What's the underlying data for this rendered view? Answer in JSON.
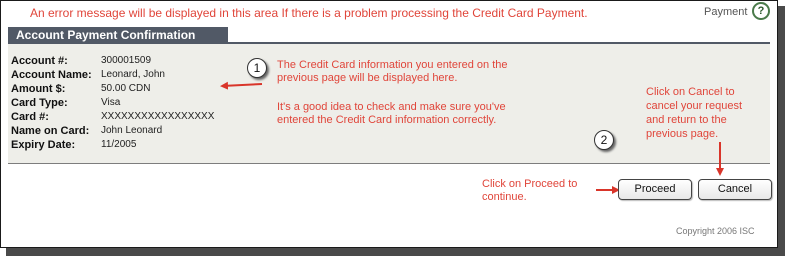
{
  "header": {
    "error_message": "An error message will be displayed in this area If there is a problem processing the Credit Card Payment.",
    "payment_label": "Payment",
    "help_icon": "?"
  },
  "section": {
    "title": "Account Payment Confirmation"
  },
  "fields": [
    {
      "label": "Account #:",
      "value": "300001509"
    },
    {
      "label": "Account Name:",
      "value": "Leonard, John"
    },
    {
      "label": "Amount $:",
      "value": "50.00 CDN"
    },
    {
      "label": "Card Type:",
      "value": "Visa"
    },
    {
      "label": "Card #:",
      "value": "XXXXXXXXXXXXXXXXX"
    },
    {
      "label": "Name on Card:",
      "value": "John Leonard"
    },
    {
      "label": "Expiry Date:",
      "value": "11/2005"
    }
  ],
  "annotations": {
    "step1_number": "1",
    "step1_line1": "The Credit Card information you entered on the",
    "step1_line2": "previous page will be displayed here.",
    "step1_note1": "It's a good idea to check and make sure you've",
    "step1_note2": "entered the Credit Card information correctly.",
    "step2_number": "2",
    "cancel_line1": "Click on Cancel to",
    "cancel_line2": "cancel your request",
    "cancel_line3": "and return to the",
    "cancel_line4": "previous page.",
    "proceed_line1": "Click on Proceed to",
    "proceed_line2": "continue."
  },
  "buttons": {
    "proceed": "Proceed",
    "cancel": "Cancel"
  },
  "footer": {
    "copyright": "Copyright 2006 ISC"
  },
  "colors": {
    "annotation_red": "#e0453a",
    "header_bar": "#515966",
    "panel_bg": "#eeeee9"
  },
  "icons": {
    "help": "help-circle-icon",
    "arrow": "red-arrow-icon"
  }
}
